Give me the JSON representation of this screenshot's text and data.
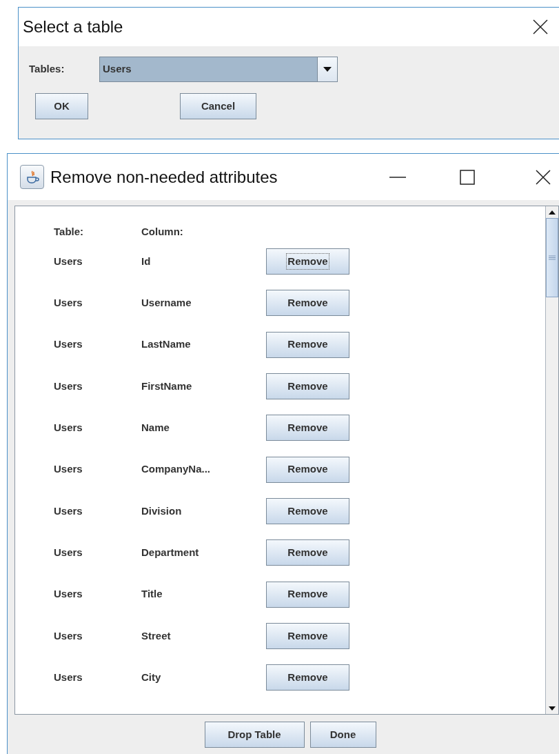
{
  "select_dialog": {
    "title": "Select a table",
    "tables_label": "Tables:",
    "tables_value": "Users",
    "buttons": [
      "OK",
      "Cancel"
    ]
  },
  "attributes_window": {
    "title": "Remove non-needed attributes",
    "headers": [
      "Table:",
      "Column:"
    ],
    "rows": [
      {
        "table": "Users",
        "column": "Id",
        "button": "Remove",
        "focused": true
      },
      {
        "table": "Users",
        "column": "Username",
        "button": "Remove",
        "focused": false
      },
      {
        "table": "Users",
        "column": "LastName",
        "button": "Remove",
        "focused": false
      },
      {
        "table": "Users",
        "column": "FirstName",
        "button": "Remove",
        "focused": false
      },
      {
        "table": "Users",
        "column": "Name",
        "button": "Remove",
        "focused": false
      },
      {
        "table": "Users",
        "column": "CompanyNa...",
        "button": "Remove",
        "focused": false
      },
      {
        "table": "Users",
        "column": "Division",
        "button": "Remove",
        "focused": false
      },
      {
        "table": "Users",
        "column": "Department",
        "button": "Remove",
        "focused": false
      },
      {
        "table": "Users",
        "column": "Title",
        "button": "Remove",
        "focused": false
      },
      {
        "table": "Users",
        "column": "Street",
        "button": "Remove",
        "focused": false
      },
      {
        "table": "Users",
        "column": "City",
        "button": "Remove",
        "focused": false
      }
    ],
    "footer_buttons": [
      "Drop Table",
      "Done"
    ]
  }
}
